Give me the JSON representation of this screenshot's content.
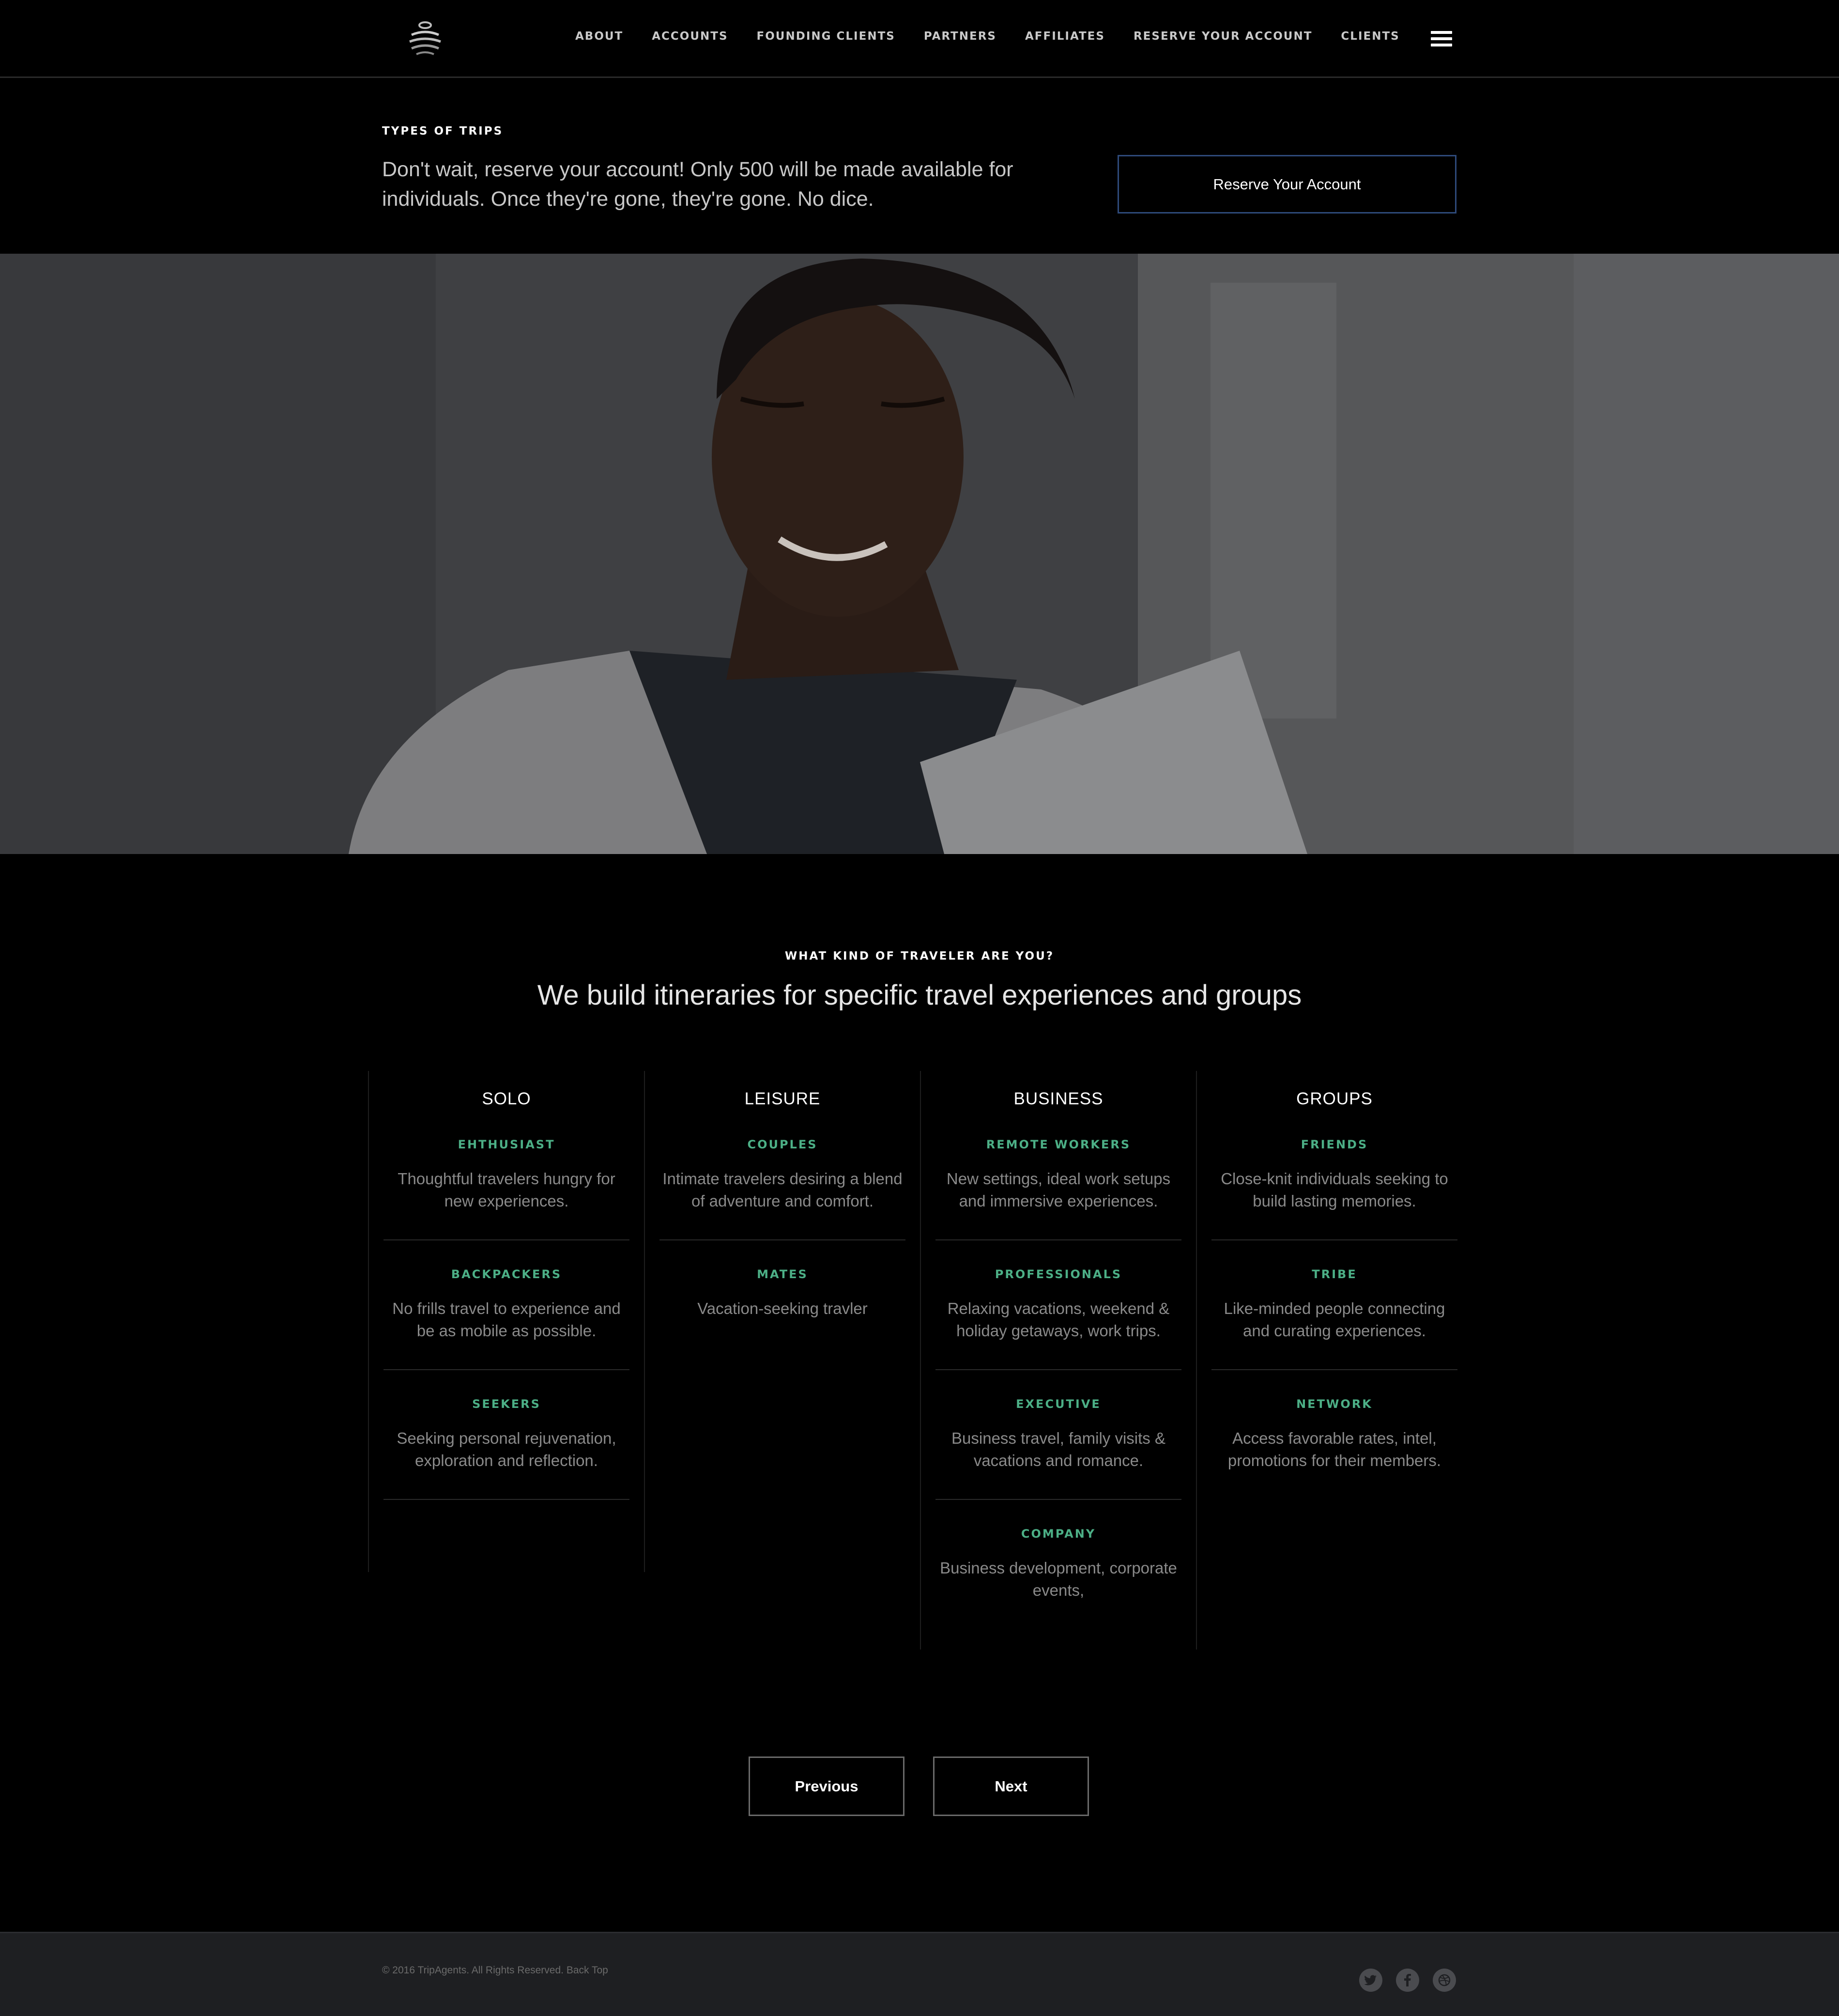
{
  "nav": {
    "logo_icon": "globe-logo-icon",
    "links": [
      "ABOUT",
      "ACCOUNTS",
      "FOUNDING CLIENTS",
      "PARTNERS",
      "AFFILIATES",
      "RESERVE YOUR ACCOUNT",
      "CLIENTS"
    ],
    "menu_icon": "hamburger-menu-icon"
  },
  "hero": {
    "kicker": "TYPES OF TRIPS",
    "text": "Don't wait, reserve your account! Only 500 will be made available for individuals. Once they're gone, they're gone. No dice.",
    "button_label": "Reserve Your Account"
  },
  "traveler": {
    "kicker": "WHAT KIND OF TRAVELER ARE YOU?",
    "title": "We build itineraries for specific travel experiences and groups",
    "columns": [
      {
        "heading": "SOLO",
        "items": [
          {
            "label": "EHTHUSIAST",
            "desc": "Thoughtful travelers hungry for new experiences."
          },
          {
            "label": "BACKPACKERS",
            "desc": "No frills travel to experience and be as mobile as possible."
          },
          {
            "label": "SEEKERS",
            "desc": "Seeking personal rejuvenation, exploration and reflection."
          }
        ]
      },
      {
        "heading": "LEISURE",
        "items": [
          {
            "label": "COUPLES",
            "desc": "Intimate travelers desiring a blend of adventure and comfort."
          },
          {
            "label": "MATES",
            "desc": "Vacation-seeking travler"
          }
        ]
      },
      {
        "heading": "BUSINESS",
        "items": [
          {
            "label": "REMOTE WORKERS",
            "desc": "New settings, ideal work setups and immersive experiences."
          },
          {
            "label": "PROFESSIONALS",
            "desc": "Relaxing vacations, weekend & holiday getaways, work trips."
          },
          {
            "label": "EXECUTIVE",
            "desc": "Business travel, family visits & vacations and romance."
          },
          {
            "label": "COMPANY",
            "desc": "Business development, corporate events,"
          }
        ]
      },
      {
        "heading": "GROUPS",
        "items": [
          {
            "label": "FRIENDS",
            "desc": "Close-knit individuals seeking to build lasting memories."
          },
          {
            "label": "TRIBE",
            "desc": "Like-minded people connecting and curating experiences."
          },
          {
            "label": "NETWORK",
            "desc": "Access favorable rates, intel, promotions for their members."
          }
        ]
      }
    ]
  },
  "pager": {
    "previous": "Previous",
    "next": "Next"
  },
  "footer": {
    "copyright": "© 2016 TripAgents. All Rights Reserved.",
    "back_top": "Back Top",
    "social_icons": [
      "twitter-icon",
      "facebook-icon",
      "dribbble-icon"
    ]
  },
  "colors": {
    "accent_green": "#4caf86",
    "button_border_blue": "#2e4a7a",
    "footer_bg": "#1e1f22"
  }
}
